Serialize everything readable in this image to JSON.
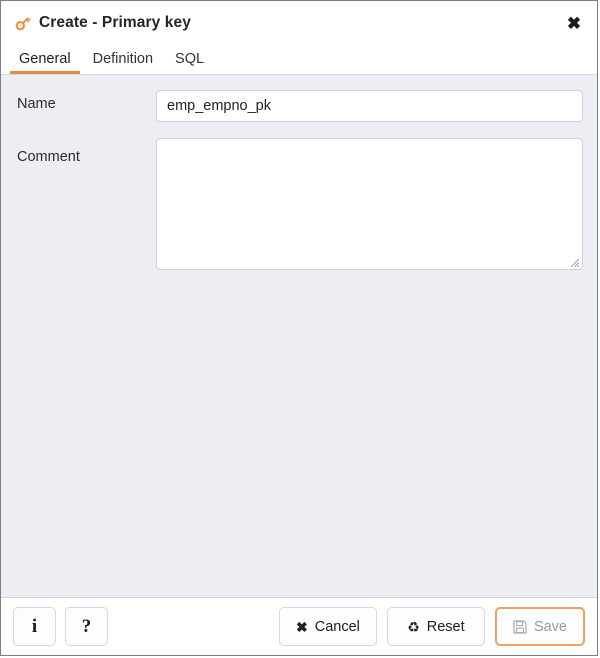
{
  "window": {
    "title": "Create - Primary key",
    "title_icon": "key-icon",
    "close_icon": "close-icon",
    "close_glyph": "✖"
  },
  "tabs": [
    {
      "label": "General",
      "active": true
    },
    {
      "label": "Definition",
      "active": false
    },
    {
      "label": "SQL",
      "active": false
    }
  ],
  "form": {
    "name": {
      "label": "Name",
      "value": "emp_empno_pk",
      "placeholder": ""
    },
    "comment": {
      "label": "Comment",
      "value": "",
      "placeholder": ""
    }
  },
  "footer": {
    "info_button": {
      "label": "i",
      "icon": "info-icon"
    },
    "help_button": {
      "label": "?",
      "icon": "help-icon"
    },
    "cancel_button": {
      "label": "Cancel",
      "glyph": "✖",
      "icon": "cancel-icon"
    },
    "reset_button": {
      "label": "Reset",
      "glyph": "♻",
      "icon": "reset-icon"
    },
    "save_button": {
      "label": "Save",
      "glyph": "💾",
      "icon": "save-icon",
      "disabled": true
    }
  },
  "colors": {
    "accent": "#e8883a",
    "save_focus_ring": "#f0a060",
    "body_background": "#eceef3",
    "panel_background": "#ffffff",
    "border": "#7a7d82",
    "text": "#222222"
  }
}
